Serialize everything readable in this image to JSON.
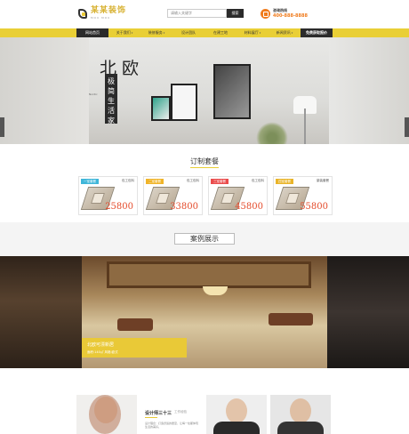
{
  "header": {
    "logo_text": "某某装饰",
    "logo_sub": "MOU MOU",
    "search_placeholder": "请输入关键字",
    "search_button": "搜索",
    "hotline_label": "咨询热线",
    "hotline_number": "400-888-8888"
  },
  "nav": {
    "items": [
      "网站首页",
      "关于我们",
      "装修服务",
      "设计团队",
      "在建工地",
      "材料展厅",
      "新闻资讯"
    ],
    "cta": "免费获取报价"
  },
  "banner": {
    "title": "北欧",
    "vertical": "极简生活家",
    "sub": "Nordic"
  },
  "packages": {
    "title": "订制套餐",
    "items": [
      {
        "tag": "一室套餐",
        "label": "包工包料",
        "price": "25800",
        "color": "#3fb6d9"
      },
      {
        "tag": "二室套餐",
        "label": "包工包料",
        "price": "33800",
        "color": "#f0b429"
      },
      {
        "tag": "三室套餐",
        "label": "包工包料",
        "price": "45800",
        "color": "#ea4c4c"
      },
      {
        "tag": "四室套餐",
        "label": "豪装套餐",
        "price": "55800",
        "color": "#e9b429"
      }
    ]
  },
  "cases": {
    "title": "案例展示",
    "caption_title": "北欧可漂新居",
    "caption_sub": "面积:140㎡ 风格:欧式"
  },
  "designer": {
    "name": "设计师三十三",
    "title": "工作经验",
    "text": "设计理念：打造舒适的居室，让每一处都体现生活的美好。"
  }
}
